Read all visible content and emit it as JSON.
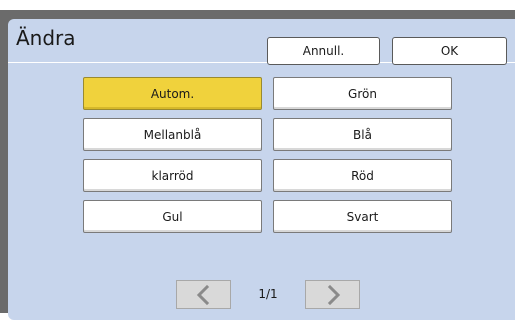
{
  "header": {
    "title": "Ändra",
    "cancel_label": "Annull.",
    "ok_label": "OK"
  },
  "options": [
    {
      "label": "Autom.",
      "selected": true
    },
    {
      "label": "Grön",
      "selected": false
    },
    {
      "label": "Mellanblå",
      "selected": false
    },
    {
      "label": "Blå",
      "selected": false
    },
    {
      "label": "klarröd",
      "selected": false
    },
    {
      "label": "Röd",
      "selected": false
    },
    {
      "label": "Gul",
      "selected": false
    },
    {
      "label": "Svart",
      "selected": false
    }
  ],
  "pager": {
    "page_text": "1/1",
    "prev_icon": "chevron-left-icon",
    "next_icon": "chevron-right-icon"
  },
  "colors": {
    "panel_bg": "#c7d5ec",
    "selected_bg": "#f0d23c",
    "frame": "#6b6b6b"
  }
}
